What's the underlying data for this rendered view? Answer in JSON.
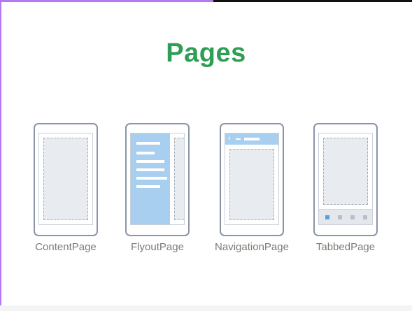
{
  "title": "Pages",
  "colors": {
    "title_green": "#2f9e55",
    "accent_purple": "#b877f2",
    "menu_blue": "#a8cff0",
    "active_tab_blue": "#5aa0dc"
  },
  "pages": [
    {
      "label": "ContentPage"
    },
    {
      "label": "FlyoutPage"
    },
    {
      "label": "NavigationPage"
    },
    {
      "label": "TabbedPage"
    }
  ],
  "icons": {
    "nav_back": "chevron-left-icon"
  }
}
